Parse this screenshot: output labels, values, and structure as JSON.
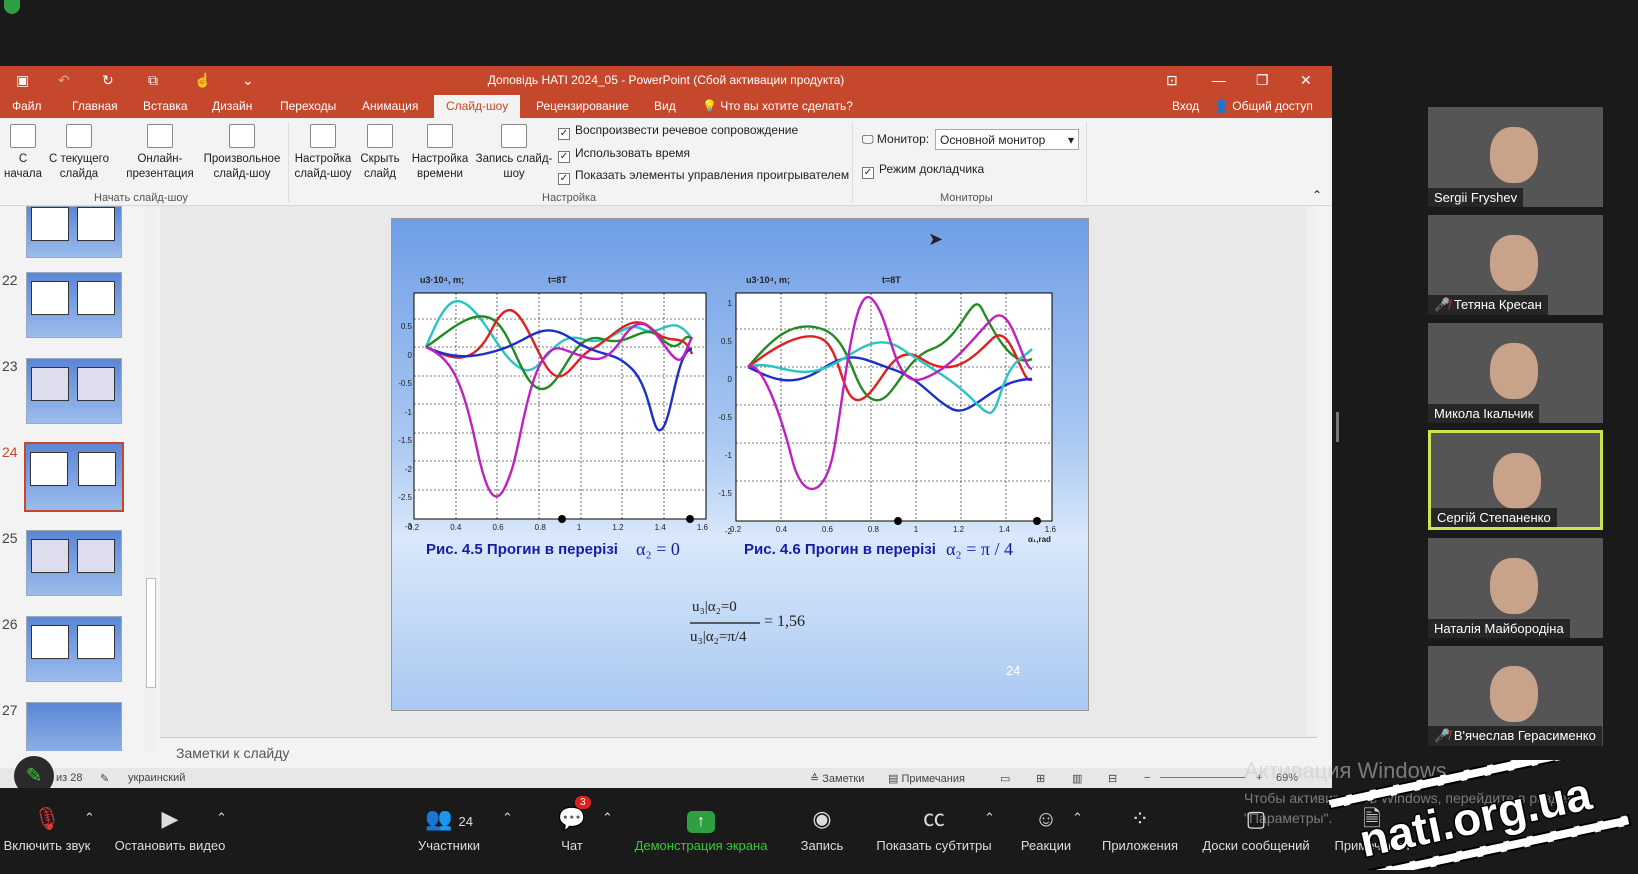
{
  "app": {
    "title": "Доповідь НАТІ 2024_05 - PowerPoint (Сбой активации продукта)"
  },
  "menu": {
    "items": [
      "Файл",
      "Главная",
      "Вставка",
      "Дизайн",
      "Переходы",
      "Анимация",
      "Слайд-шоу",
      "Рецензирование",
      "Вид"
    ],
    "search": "Что вы хотите сделать?",
    "login": "Вход",
    "share": "Общий доступ"
  },
  "ribbon": {
    "from_start": "С\nначала",
    "from_current": "С текущего\nслайда",
    "online": "Онлайн-\nпрезентация",
    "custom": "Произвольное\nслайд-шоу",
    "setup": "Настройка\nслайд-шоу",
    "hide": "Скрыть\nслайд",
    "timing": "Настройка\nвремени",
    "record": "Запись слайд-\nшоу",
    "group_start": "Начать слайд-шоу",
    "group_setup": "Настройка",
    "group_monitors": "Мониторы",
    "chk_narration": "Воспроизвести речевое сопровождение",
    "chk_timing": "Использовать время",
    "chk_controls": "Показать элементы управления проигрывателем",
    "monitor_label": "Монитор:",
    "monitor_value": "Основной монитор",
    "presenter": "Режим докладчика"
  },
  "thumbs": [
    "22",
    "23",
    "24",
    "25",
    "26",
    "27"
  ],
  "slide": {
    "plot1": {
      "ylabel": "u3·10⁴, m;",
      "t": "t=8T",
      "yticks": [
        "0.5",
        "0",
        "-0.5",
        "-1",
        "-1.5",
        "-2",
        "-2.5",
        "-3"
      ],
      "xticks": [
        "0.2",
        "0.4",
        "0.6",
        "0.8",
        "1",
        "1.2",
        "1.4",
        "1.6"
      ]
    },
    "plot2": {
      "ylabel": "u3·10⁴, m;",
      "t": "t=8T",
      "yticks": [
        "1",
        "0.5",
        "0",
        "-0.5",
        "-1",
        "-1.5",
        "-2"
      ],
      "xticks": [
        "0.2",
        "0.4",
        "0.6",
        "0.8",
        "1",
        "1.2",
        "1.4",
        "1.6"
      ],
      "xlabel": "α₁,rad"
    },
    "caption1": "Рис. 4.5 Прогин в перерізі",
    "cap1_math": "α₂ = 0",
    "caption2": "Рис. 4.6 Прогин в перерізі",
    "cap2_math": "α₂ = π / 4",
    "formula": "= 1,56",
    "formula_num": "u₃|α₂=0",
    "formula_den": "u₃|α₂=π/4",
    "page": "24"
  },
  "notes": "Заметки к слайду",
  "status": {
    "slide_count": "из 28",
    "lang": "украинский",
    "notes": "Заметки",
    "comments": "Примечания",
    "zoom": "69%"
  },
  "participants": [
    {
      "name": "Sergii Fryshev"
    },
    {
      "name": "Тетяна Кресан"
    },
    {
      "name": "Микола Ікальчик"
    },
    {
      "name": "Сергій Степаненко"
    },
    {
      "name": "Наталія Майбородіна"
    },
    {
      "name": "В'ячеслав Герасименко"
    }
  ],
  "zoom": {
    "mute": "Включить звук",
    "video": "Остановить видео",
    "participants": "Участники",
    "participants_count": "24",
    "chat": "Чат",
    "chat_badge": "3",
    "share": "Демонстрация экрана",
    "record": "Запись",
    "cc": "Показать субтитры",
    "reactions": "Реакции",
    "apps": "Приложения",
    "whiteboard": "Доски сообщений",
    "notes": "Примечания"
  },
  "watermark": {
    "title": "Активация Windows",
    "text": "Чтобы активировать Windows, перейдите в раздел \"Параметры\"."
  },
  "stamp": "nati.org.ua"
}
